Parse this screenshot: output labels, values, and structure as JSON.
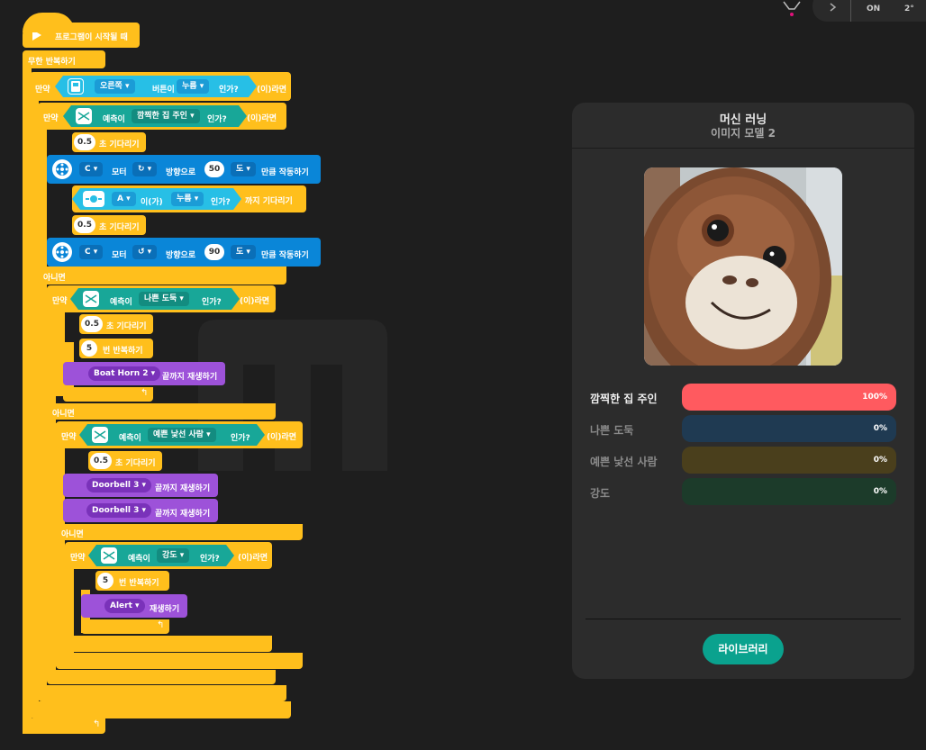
{
  "blocks": {
    "start": "프로그램이 시작될 때",
    "forever": "무한 반복하기",
    "if": "만약",
    "then": "(이)라면",
    "else": "아니면",
    "button_side": "오른쪽",
    "button_word": "버튼이",
    "pressed": "누름",
    "question": "인가?",
    "predict": "예측이",
    "class_1": "깜찍한 집 주인",
    "class_2": "나쁜 도둑",
    "class_3": "예쁜 낯선 사람",
    "class_4": "강도",
    "wait_sec": "초 기다리기",
    "wait_value": "0.5",
    "motor_port": "C",
    "motor_word": "모터",
    "direction_word": "방향으로",
    "motor_deg_1": "50",
    "motor_deg_2": "90",
    "deg_unit": "도",
    "run_motor": "만큼 작동하기",
    "sensor_port": "A",
    "sensor_word": "이(가)",
    "wait_until": "까지 기다리기",
    "repeat_count": "5",
    "repeat": "번 반복하기",
    "sound_1": "Boat Horn 2",
    "sound_2": "Doorbell 3",
    "sound_3": "Alert",
    "play_until_done": "끝까지 재생하기",
    "play": "재생하기"
  },
  "top_status": {
    "value_1": "ON",
    "value_2": "2°"
  },
  "panel": {
    "title": "머신 러닝",
    "subtitle": "이미지 모델 2",
    "library_button": "라이브러리",
    "results": [
      {
        "label": "깜찍한 집 주인",
        "value": "100%",
        "fraction": 1.0,
        "color": "#ff5a5f",
        "track": "#ff5a5f"
      },
      {
        "label": "나쁜 도둑",
        "value": "0%",
        "fraction": 0,
        "color": "#1f3a52",
        "track": "#1f3a52"
      },
      {
        "label": "예쁜 낯선 사람",
        "value": "0%",
        "fraction": 0,
        "color": "#4a3f1c",
        "track": "#4a3f1c"
      },
      {
        "label": "강도",
        "value": "0%",
        "fraction": 0,
        "color": "#1c3b2a",
        "track": "#1c3b2a"
      }
    ]
  }
}
